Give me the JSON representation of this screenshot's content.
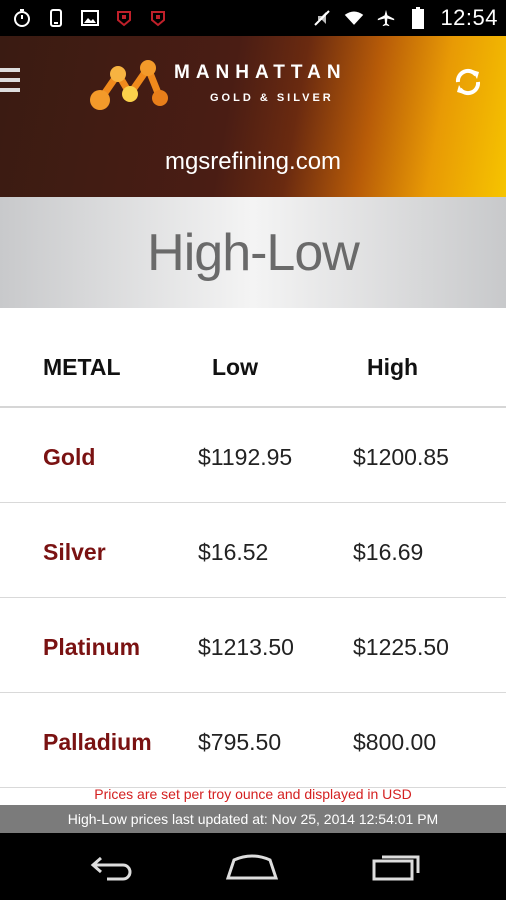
{
  "status_bar": {
    "time": "12:54",
    "left_icons": [
      "stopwatch-icon",
      "phone-vibrate-icon",
      "image-icon",
      "app-notification-icon",
      "app-notification-icon"
    ],
    "right_icons": [
      "mute-icon",
      "wifi-icon",
      "airplane-icon",
      "battery-icon"
    ]
  },
  "header": {
    "brand_name": "MANHATTAN",
    "brand_sub": "GOLD & SILVER",
    "site_url": "mgsrefining.com"
  },
  "page": {
    "title": "High-Low"
  },
  "table": {
    "headers": {
      "metal": "METAL",
      "low": "Low",
      "high": "High"
    },
    "rows": [
      {
        "metal": "Gold",
        "low": "$1192.95",
        "high": "$1200.85"
      },
      {
        "metal": "Silver",
        "low": "$16.52",
        "high": "$16.69"
      },
      {
        "metal": "Platinum",
        "low": "$1213.50",
        "high": "$1225.50"
      },
      {
        "metal": "Palladium",
        "low": "$795.50",
        "high": "$800.00"
      }
    ]
  },
  "footer": {
    "price_note": "Prices are set per troy ounce and displayed in USD",
    "updated": "High-Low prices last updated at: Nov 25, 2014 12:54:01 PM"
  },
  "colors": {
    "metal_name": "#7a1212",
    "note_red": "#d42020",
    "update_bar": "#7b7b7b",
    "header_dark": "#3a1b12",
    "header_gold": "#f6c400"
  }
}
